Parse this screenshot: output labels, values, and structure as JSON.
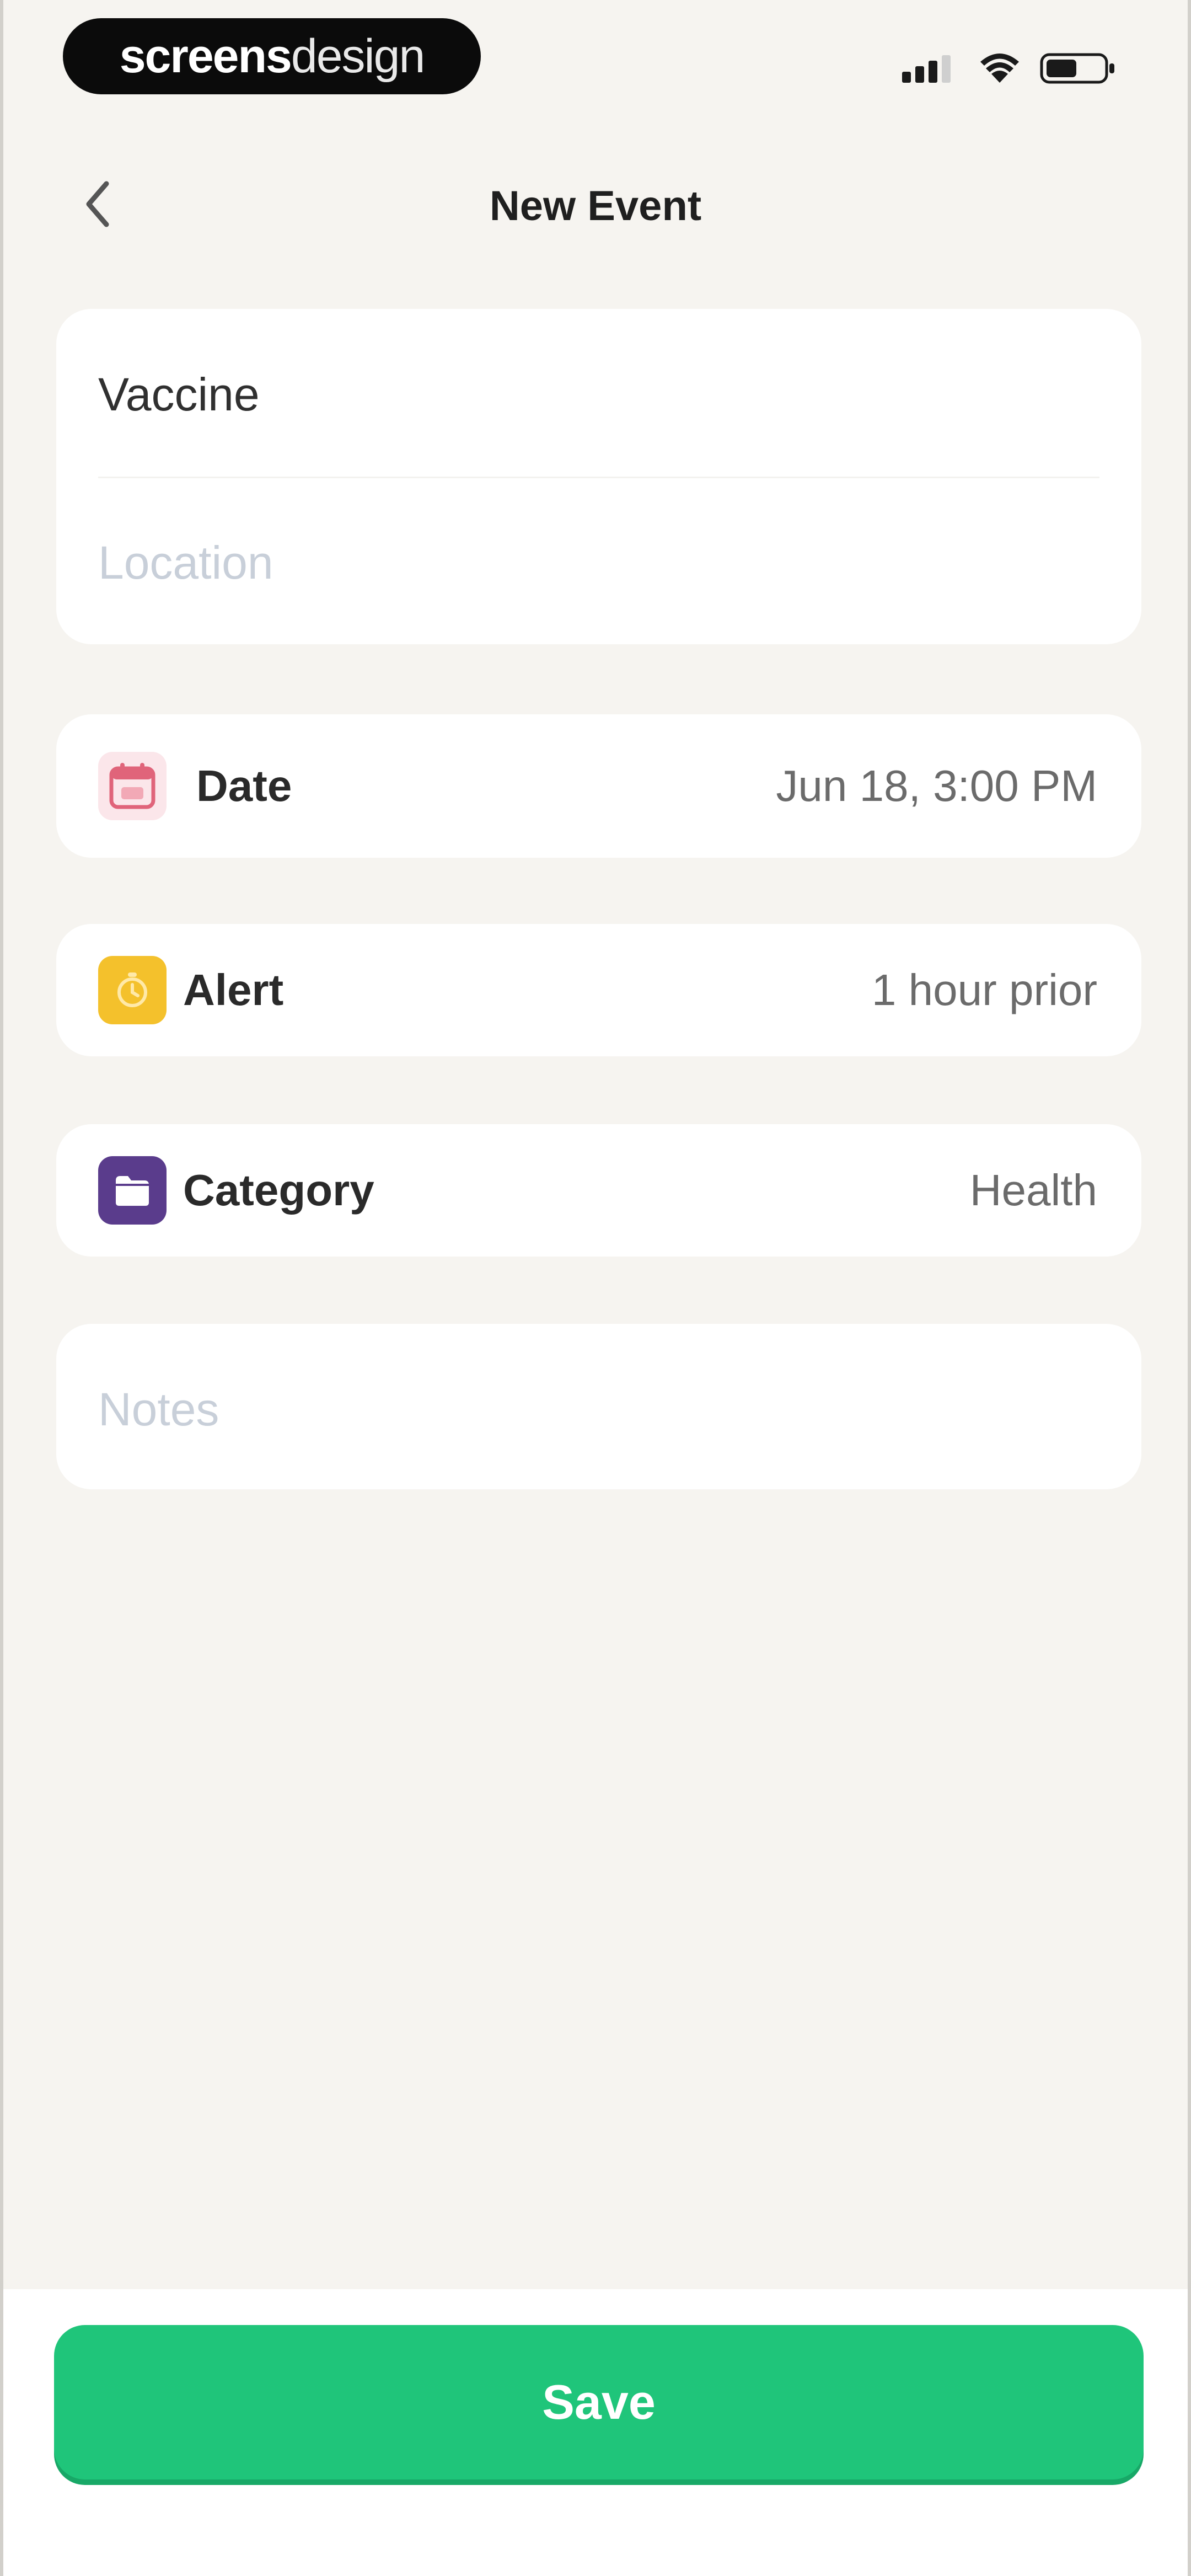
{
  "status_bar": {
    "brand_bold": "screens",
    "brand_light": "design",
    "signal_icon": "cellular-signal-icon",
    "wifi_icon": "wifi-icon",
    "battery_icon": "battery-icon"
  },
  "nav": {
    "back_icon": "chevron-left-icon",
    "title": "New Event"
  },
  "form": {
    "title_value": "Vaccine",
    "location_placeholder": "Location",
    "date": {
      "icon": "calendar-icon",
      "label": "Date",
      "value": "Jun 18, 3:00 PM"
    },
    "alert": {
      "icon": "alarm-clock-icon",
      "label": "Alert",
      "value": "1 hour prior"
    },
    "category": {
      "icon": "folder-icon",
      "label": "Category",
      "value": "Health"
    },
    "notes_placeholder": "Notes"
  },
  "actions": {
    "save_label": "Save"
  },
  "colors": {
    "background": "#f6f4f0",
    "card": "#ffffff",
    "accent_green": "#1fc57a",
    "date_icon_bg": "#fbe6ea",
    "date_icon_fg": "#e0647a",
    "alert_icon_bg": "#f4c12c",
    "category_icon_bg": "#5a3c8c",
    "placeholder": "#c8cfd9"
  }
}
